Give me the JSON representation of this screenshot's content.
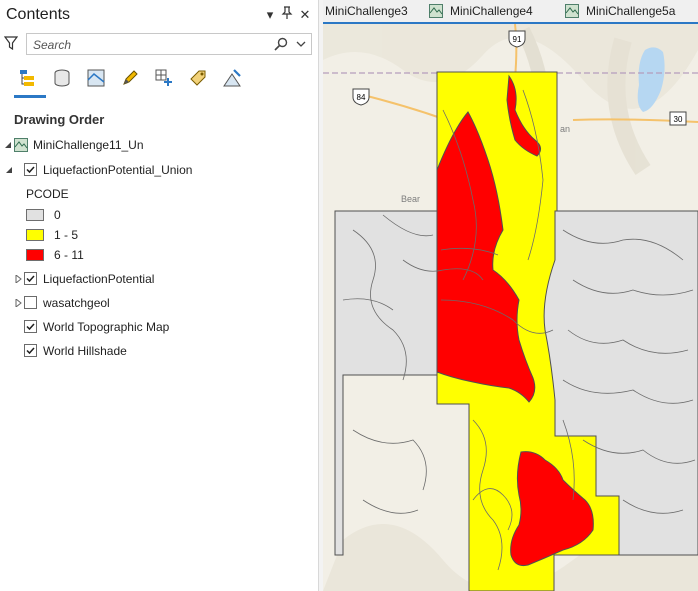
{
  "contents": {
    "title": "Contents",
    "search_placeholder": "Search",
    "toolbar_icons": [
      "drawing-order-icon",
      "data-source-icon",
      "selection-icon",
      "editing-icon",
      "snapping-icon",
      "labeling-icon",
      "charts-icon"
    ],
    "section_title": "Drawing Order",
    "map_name": "MiniChallenge11_Un",
    "layers": [
      {
        "name": "LiquefactionPotential_Union",
        "checked": true,
        "expanded": true
      },
      {
        "name": "LiquefactionPotential",
        "checked": true,
        "expanded": false
      },
      {
        "name": "wasatchgeol",
        "checked": false,
        "expanded": false
      },
      {
        "name": "World Topographic Map",
        "checked": true
      },
      {
        "name": "World Hillshade",
        "checked": true
      }
    ],
    "legend": {
      "field": "PCODE",
      "classes": [
        {
          "label": "0",
          "color": "#e1e1e1"
        },
        {
          "label": "1 - 5",
          "color": "#ffff00"
        },
        {
          "label": "6 - 11",
          "color": "#ff0000"
        }
      ]
    }
  },
  "map": {
    "tabs": [
      {
        "label": "MiniChallenge3"
      },
      {
        "label": "MiniChallenge4"
      },
      {
        "label": "MiniChallenge5a"
      }
    ],
    "road_shields": [
      "91",
      "84",
      "30"
    ],
    "place_labels": [
      "Bear",
      "an"
    ],
    "colors": {
      "zero": "#e1e1e1",
      "low": "#ffff00",
      "high": "#ff0000",
      "basemap": "#f2efe6",
      "water": "#b6d7f2",
      "accent": "#2b78c5"
    }
  }
}
